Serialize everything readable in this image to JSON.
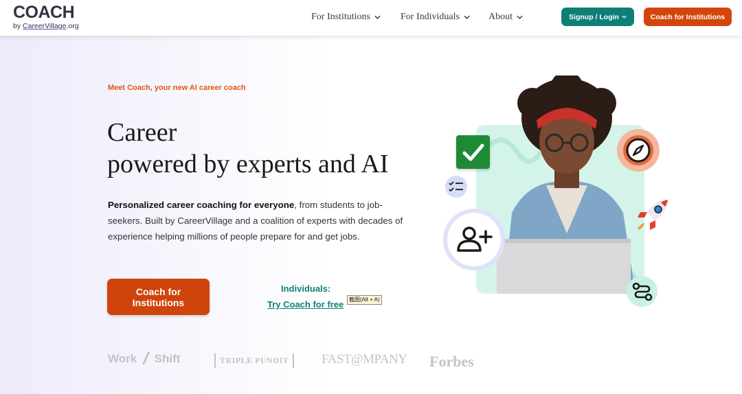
{
  "header": {
    "logo": {
      "word": "COACH",
      "sub_prefix": "by ",
      "sub_link": "CareerVillage",
      "sub_suffix": ".org"
    },
    "nav": [
      {
        "label": "For Institutions"
      },
      {
        "label": "For Individuals"
      },
      {
        "label": "About"
      }
    ],
    "signup_label": "Signup / Login",
    "institutions_label": "Coach for Institutions"
  },
  "hero": {
    "eyebrow": "Meet Coach, your new AI career coach",
    "headline_line1": "Career",
    "headline_line2": "powered by experts and AI",
    "desc_bold": "Personalized career coaching for everyone",
    "desc_rest": ", from students to job-seekers. Built by CareerVillage and a coalition of experts with decades of experience helping millions of people prepare for and get jobs.",
    "cta_institutions": "Coach for Institutions",
    "individuals_label": "Individuals:",
    "individuals_link": "Try Coach for free",
    "tooltip": "截图(Alt + A)"
  },
  "press": {
    "workshift": "Work",
    "workshift_b": "Shift",
    "triplepundit": "TRIPLE PUNDIT",
    "fastcompany": "FAST@MPANY",
    "forbes": "Forbes"
  },
  "colors": {
    "teal": "#0e7f76",
    "orange": "#d2460e",
    "eyebrow": "#e0560f",
    "press_gray": "#c3c3c6"
  },
  "icons": [
    "checkmark-icon",
    "compass-icon",
    "checklist-icon",
    "add-user-icon",
    "rocket-icon",
    "route-icon",
    "chevron-down-icon"
  ]
}
